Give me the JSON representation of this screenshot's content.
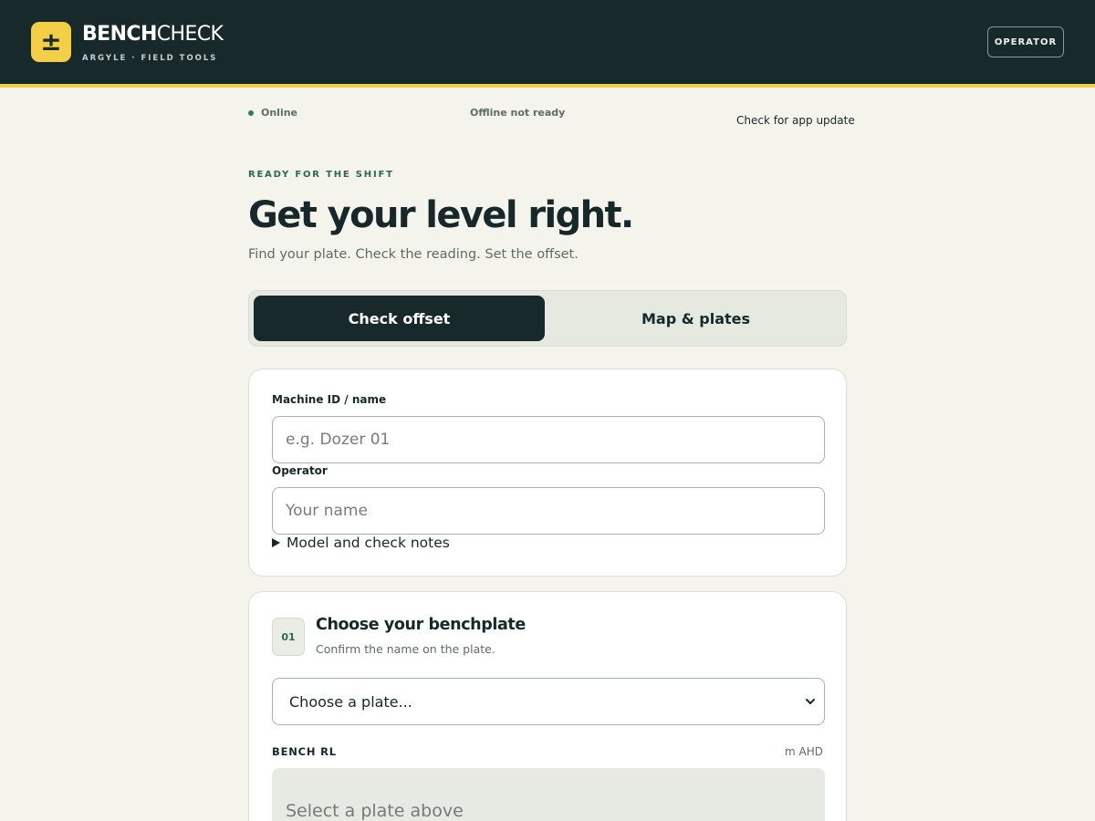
{
  "header": {
    "logo_glyph": "±",
    "brand_bold": "BENCH",
    "brand_light": "CHECK",
    "brand_sub": "ARGYLE · FIELD TOOLS",
    "operator_label": "OPERATOR",
    "colors": {
      "bar": "#17292b",
      "accent": "#f3cf47"
    }
  },
  "status": {
    "online": "Online",
    "offline": "Offline not ready",
    "update_link": "Check for app update",
    "online_color": "#2f7d57"
  },
  "hero": {
    "eyebrow": "READY FOR THE SHIFT",
    "title": "Get your level right.",
    "subtitle": "Find your plate. Check the reading. Set the offset."
  },
  "tabs": [
    {
      "label": "Check offset",
      "active": true
    },
    {
      "label": "Map & plates",
      "active": false
    }
  ],
  "machine_card": {
    "machine_label": "Machine ID / name",
    "machine_placeholder": "e.g. Dozer 01",
    "machine_value": "",
    "operator_label": "Operator",
    "operator_placeholder": "Your name",
    "operator_value": "",
    "notes_summary": "Model and check notes"
  },
  "step1": {
    "number": "01",
    "title": "Choose your benchplate",
    "subtitle": "Confirm the name on the plate.",
    "select_value": "Choose a plate...",
    "bench_label": "BENCH RL",
    "bench_unit": "m AHD",
    "bench_value": "Select a plate above"
  }
}
